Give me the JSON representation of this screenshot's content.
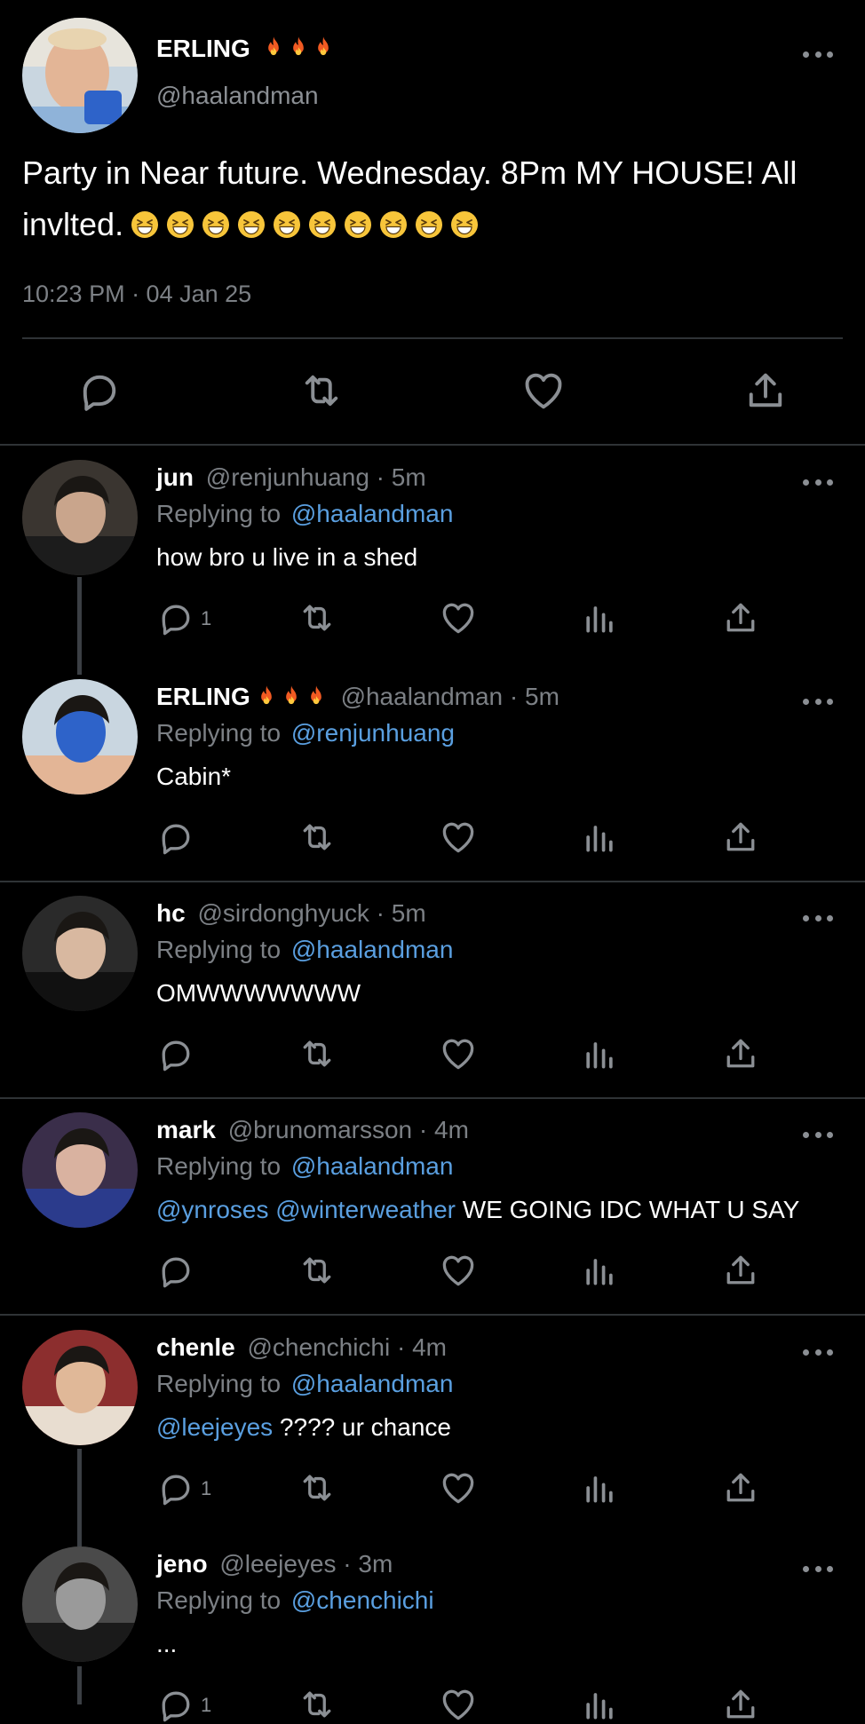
{
  "colors": {
    "background": "#000000",
    "text": "#e7e9ea",
    "muted": "#7c8085",
    "link": "#5a9fe0",
    "divider": "#2f3336"
  },
  "main_tweet": {
    "name": "ERLING",
    "name_emoji": "🔥🔥🔥",
    "handle": "@haalandman",
    "text": "Party in Near future. Wednesday. 8Pm MY HOUSE! All invlted.",
    "emoji_count": 10,
    "timestamp": "10:23 PM · 04 Jan 25",
    "actions": [
      "reply-icon",
      "retweet-icon",
      "like-icon",
      "share-icon"
    ]
  },
  "replies": [
    {
      "name": "jun",
      "handle": "@renjunhuang · 5m",
      "replying_label": "Replying to",
      "replying_to": "@haalandman",
      "mentions": "",
      "text": "how bro u live in a shed",
      "reply_count": "1",
      "avatar": "avatar-jun"
    },
    {
      "name": "ERLING",
      "name_emoji": "🔥🔥🔥",
      "handle": "@haalandman · 5m",
      "replying_label": "Replying to",
      "replying_to": "@renjunhuang",
      "mentions": "",
      "text": "Cabin*",
      "reply_count": "",
      "avatar": "avatar-erling"
    },
    {
      "name": "hc",
      "handle": "@sirdonghyuck · 5m",
      "replying_label": "Replying to",
      "replying_to": "@haalandman",
      "mentions": "",
      "text": "OMWWWWWWW",
      "reply_count": "",
      "avatar": "avatar-hc"
    },
    {
      "name": "mark",
      "handle": "@brunomarsson · 4m",
      "replying_label": "Replying to",
      "replying_to": "@haalandman",
      "mentions": "@ynroses @winterweather",
      "text": " WE GOING IDC WHAT U SAY",
      "reply_count": "",
      "avatar": "avatar-mark"
    },
    {
      "name": "chenle",
      "handle": "@chenchichi · 4m",
      "replying_label": "Replying to",
      "replying_to": "@haalandman",
      "mentions": "@leejeyes",
      "text": " ???? ur chance",
      "reply_count": "1",
      "avatar": "avatar-chenle"
    },
    {
      "name": "jeno",
      "handle": "@leejeyes · 3m",
      "replying_label": "Replying to",
      "replying_to": "@chenchichi",
      "mentions": "",
      "text": "...",
      "reply_count": "1",
      "avatar": "avatar-jeno"
    }
  ],
  "reply_actions": [
    "reply-icon",
    "retweet-icon",
    "like-icon",
    "views-icon",
    "share-icon"
  ]
}
